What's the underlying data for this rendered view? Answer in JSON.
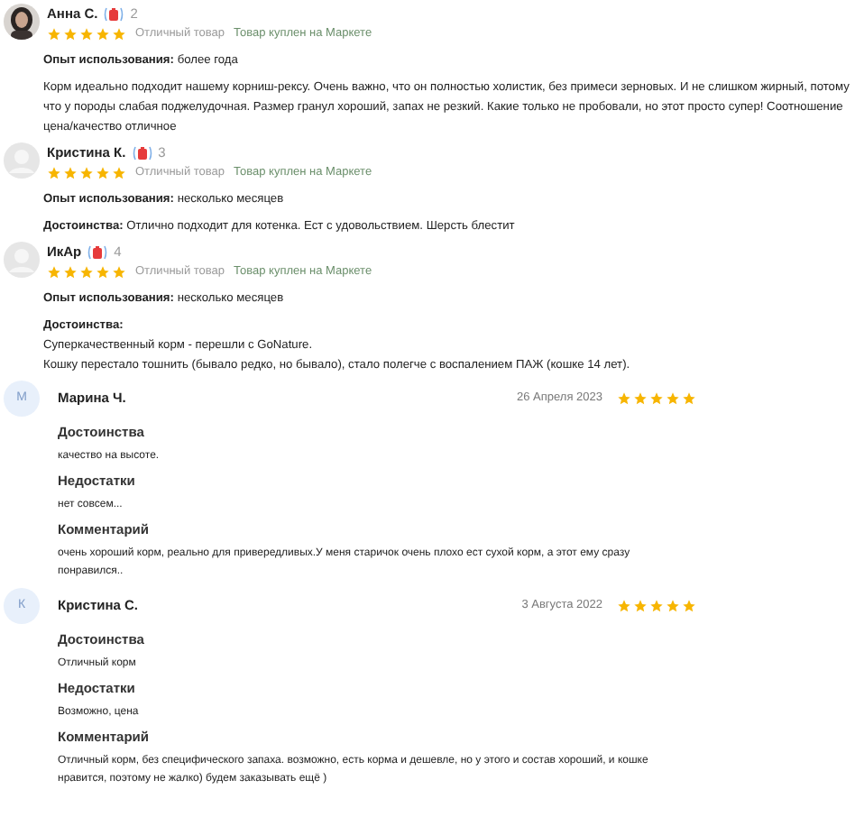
{
  "market_reviews": [
    {
      "author": "Анна С.",
      "count": "2",
      "photo": true,
      "stars": 5,
      "verdict": "Отличный товар",
      "purchase": "Товар куплен на Маркете",
      "fields": [
        {
          "kind": "inline",
          "label": "Опыт использования:",
          "text": "более года"
        },
        {
          "kind": "plain",
          "text": "Корм идеально подходит нашему корниш-рексу. Очень важно, что он полностью холистик, без примеси зерновых. И не слишком жирный, потому что у породы слабая поджелудочная. Размер гранул хороший, запах не резкий. Какие только не пробовали, но этот просто супер! Соотношение цена/качество отличное"
        }
      ]
    },
    {
      "author": "Кристина К.",
      "count": "3",
      "photo": false,
      "stars": 5,
      "verdict": "Отличный товар",
      "purchase": "Товар куплен на Маркете",
      "fields": [
        {
          "kind": "inline",
          "label": "Опыт использования:",
          "text": "несколько месяцев"
        },
        {
          "kind": "inline",
          "label": "Достоинства:",
          "text": "Отлично подходит для котенка. Ест с удовольствием. Шерсть блестит"
        }
      ]
    },
    {
      "author": "ИкАр",
      "count": "4",
      "photo": false,
      "stars": 5,
      "verdict": "Отличный товар",
      "purchase": "Товар куплен на Маркете",
      "fields": [
        {
          "kind": "inline",
          "label": "Опыт использования:",
          "text": "несколько месяцев"
        },
        {
          "kind": "block",
          "label": "Достоинства:",
          "lines": [
            "Суперкачественный корм - перешли с GoNature.",
            "Кошку перестало тошнить (бывало редко, но бывало), стало полегче с воспалением ПАЖ (кошке 14 лет)."
          ]
        }
      ]
    }
  ],
  "site_reviews": [
    {
      "initial": "М",
      "author": "Марина Ч.",
      "date": "26 Апреля 2023",
      "stars": 5,
      "sections": [
        {
          "title": "Достоинства",
          "text": "качество на высоте."
        },
        {
          "title": "Недостатки",
          "text": "нет совсем..."
        },
        {
          "title": "Комментарий",
          "text": "очень хороший корм, реально для привередливых.У меня старичок очень плохо ест сухой корм, а этот ему сразу понравился.."
        }
      ]
    },
    {
      "initial": "К",
      "author": "Кристина С.",
      "date": "3 Августа 2022",
      "stars": 5,
      "sections": [
        {
          "title": "Достоинства",
          "text": "Отличный корм"
        },
        {
          "title": "Недостатки",
          "text": "Возможно, цена"
        },
        {
          "title": "Комментарий",
          "text": "Отличный корм, без специфического запаха. возможно, есть корма и дешевле, но у этого и состав хороший, и кошке нравится, поэтому не жалко) будем заказывать ещё )"
        }
      ]
    }
  ]
}
